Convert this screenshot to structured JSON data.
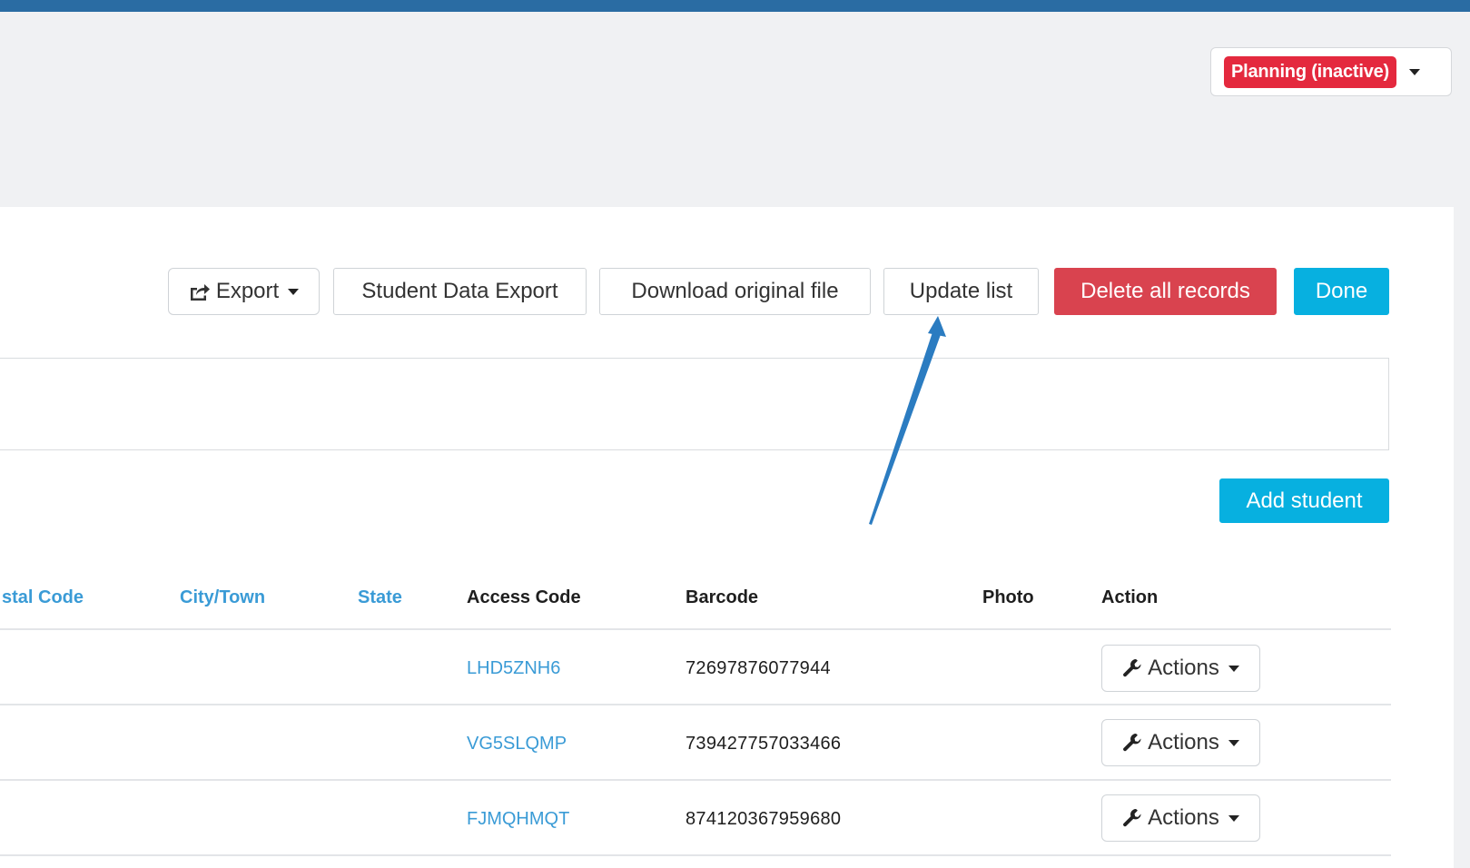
{
  "header": {
    "status_label": "Planning (inactive)",
    "status_color": "#e4293e",
    "bar_color": "#2a6ca3"
  },
  "toolbar": {
    "export_label": "Export",
    "student_data_export_label": "Student Data Export",
    "download_original_label": "Download original file",
    "update_list_label": "Update list",
    "delete_all_label": "Delete all records",
    "done_label": "Done",
    "add_student_label": "Add student"
  },
  "table": {
    "columns": [
      {
        "label": "stal Code",
        "sortable": true
      },
      {
        "label": "City/Town",
        "sortable": true
      },
      {
        "label": "State",
        "sortable": true
      },
      {
        "label": "Access Code",
        "sortable": false
      },
      {
        "label": "Barcode",
        "sortable": false
      },
      {
        "label": "Photo",
        "sortable": false
      },
      {
        "label": "Action",
        "sortable": false
      }
    ],
    "rows": [
      {
        "access_code": "LHD5ZNH6",
        "barcode": "72697876077944",
        "action_label": "Actions"
      },
      {
        "access_code": "VG5SLQMP",
        "barcode": "739427757033466",
        "action_label": "Actions"
      },
      {
        "access_code": "FJMQHMQT",
        "barcode": "874120367959680",
        "action_label": "Actions"
      }
    ]
  },
  "icons": {
    "export": "share-icon",
    "actions": "wrench-icon",
    "dropdown": "caret-down-icon"
  },
  "annotation": {
    "arrow_color": "#2b7cc1",
    "points_to": "update-list-button"
  }
}
